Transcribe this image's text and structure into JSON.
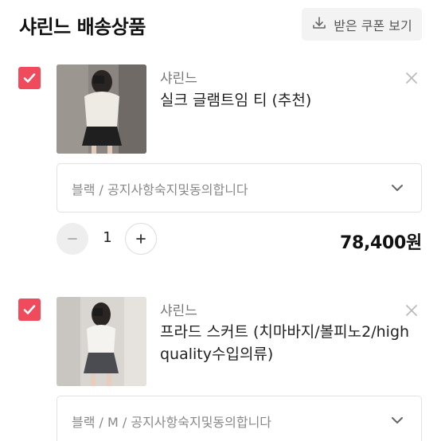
{
  "header": {
    "title": "샤린느 배송상품",
    "coupon_label": "받은 쿠폰 보기",
    "coupon_icon": "download-icon"
  },
  "items": [
    {
      "checked": true,
      "shop": "샤린느",
      "name": "실크 글램트임 티 (추천)",
      "option": "블랙 / 공지사항숙지및동의합니다",
      "quantity": "1",
      "price": "78,400원"
    },
    {
      "checked": true,
      "shop": "샤린느",
      "name": "프라드 스커트 (치마바지/볼피노2/high quality수입의류)",
      "option": "블랙 / M / 공지사항숙지및동의합니다"
    }
  ],
  "colors": {
    "accent": "#f04b5c",
    "muted_text": "#888888",
    "border": "#e2e2e2"
  }
}
